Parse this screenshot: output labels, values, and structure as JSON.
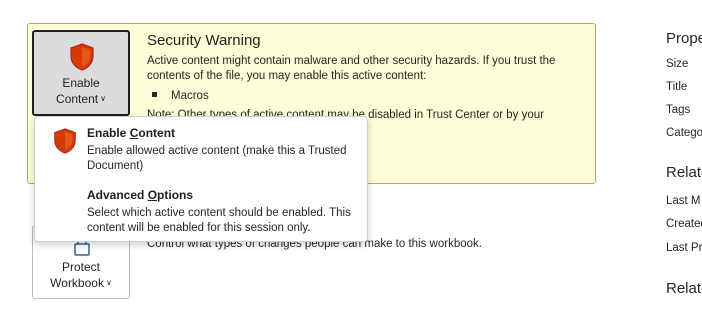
{
  "security_warning": {
    "title": "Security Warning",
    "body": "Active content might contain malware and other security hazards. If you trust the contents of the file, you may enable this active content:",
    "bullet": "Macros",
    "note": "Note: Other types of active content may be disabled in Trust Center or by your",
    "enable_button": {
      "line1": "Enable",
      "line2": "Content",
      "icon": "shield-icon"
    }
  },
  "dropdown": {
    "items": [
      {
        "title_pre": "Enable ",
        "title_accel": "C",
        "title_post": "ontent",
        "description": "Enable allowed active content (make this a Trusted Document)",
        "icon": "shield-icon"
      },
      {
        "title_pre": "Advanced ",
        "title_accel": "O",
        "title_post": "ptions",
        "description": "Select which active content should be enabled. This content will be enabled for this session only."
      }
    ]
  },
  "protect": {
    "button_line1": "Protect",
    "button_line2": "Workbook",
    "description": "Control what types of changes people can make to this workbook.",
    "icon": "lock-icon"
  },
  "properties": {
    "heading": "Prope",
    "items": [
      "Size",
      "Title",
      "Tags",
      "Catego"
    ],
    "related_dates_heading": "Relate",
    "related_dates": [
      "Last M",
      "Created",
      "Last Pr"
    ],
    "related_people_heading": "Relate"
  },
  "colors": {
    "warning_bg": "#fdfdd7",
    "warning_border": "#b6a961",
    "shield_red": "#d83b01",
    "shield_outline": "#a4262c"
  }
}
